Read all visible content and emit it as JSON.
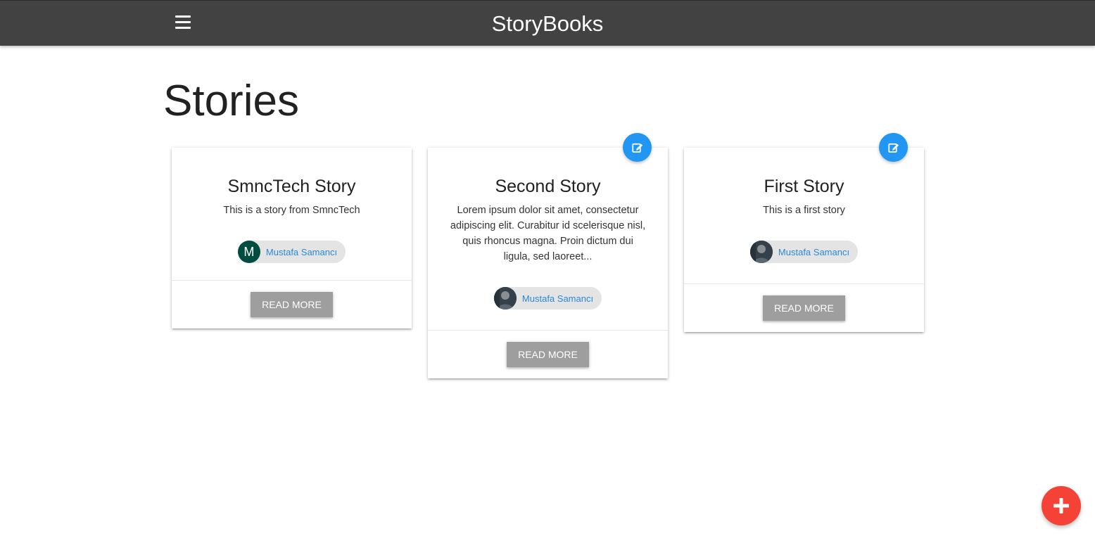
{
  "navbar": {
    "brand": "StoryBooks",
    "menu_icon": "hamburger-menu-icon"
  },
  "page": {
    "title": "Stories"
  },
  "stories": [
    {
      "title": "SmncTech Story",
      "body": "This is a story from SmncTech",
      "author": "Mustafa Samancı",
      "avatar_letter": "M",
      "avatar_type": "letter",
      "button": "READ MORE",
      "editable": false
    },
    {
      "title": "Second Story",
      "body": "Lorem ipsum dolor sit amet, consectetur adipiscing elit. Curabitur id scelerisque nisl, quis rhoncus magna. Proin dictum dui ligula, sed laoreet...",
      "author": "Mustafa Samancı",
      "avatar_type": "photo",
      "button": "READ MORE",
      "editable": true,
      "edit_icon": "edit-icon"
    },
    {
      "title": "First Story",
      "body": "This is a first story",
      "author": "Mustafa Samancı",
      "avatar_type": "photo",
      "button": "READ MORE",
      "editable": true,
      "edit_icon": "edit-icon"
    }
  ],
  "fab": {
    "icon": "plus-icon"
  },
  "colors": {
    "navbar": "#424242",
    "edit_button": "#2196f3",
    "fab": "#f44336",
    "read_more": "#9e9e9e",
    "chip_name": "#2a8ad8",
    "avatar_letter_bg": "#004d40"
  }
}
